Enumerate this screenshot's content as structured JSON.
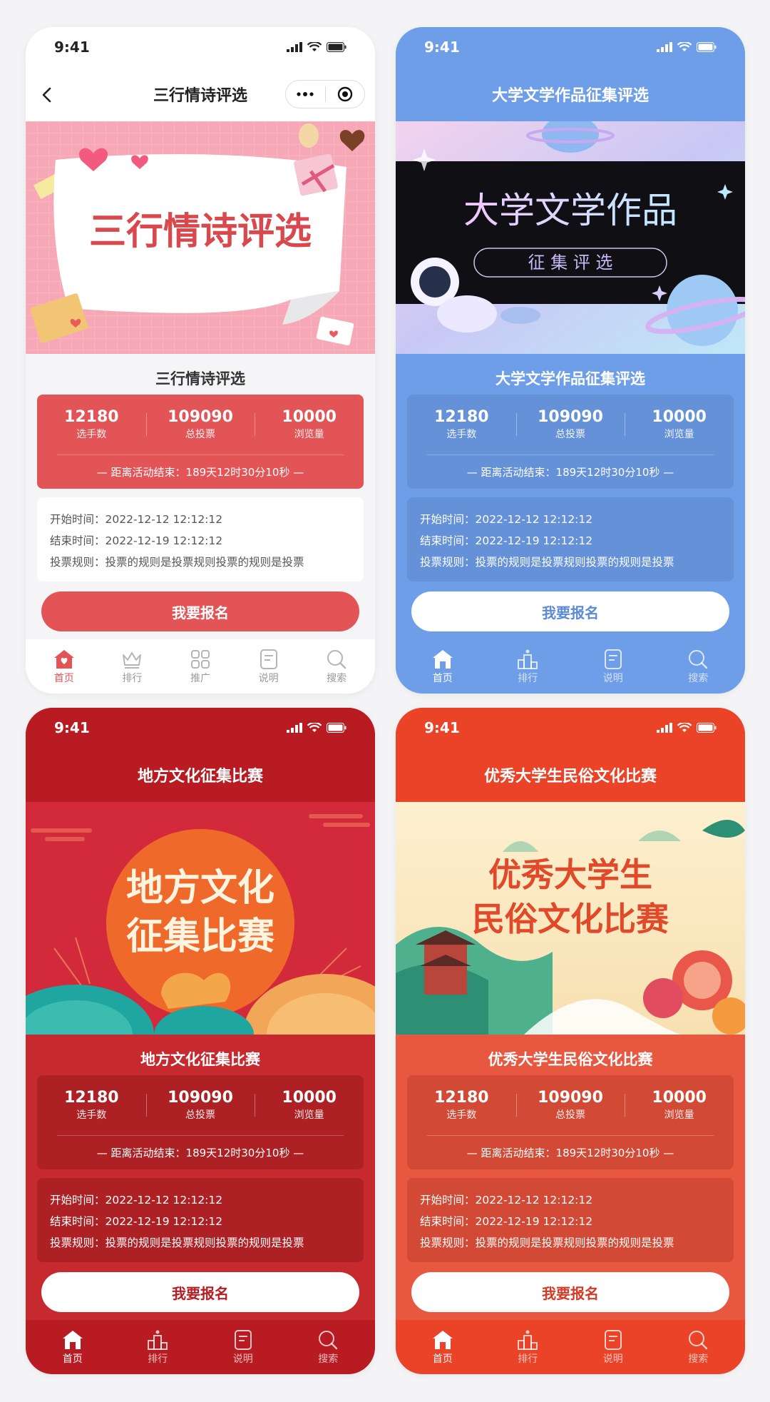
{
  "status_time": "9:41",
  "colors": {
    "pink_theme": "#e35457",
    "blue_theme": "#6f9ee8",
    "red_theme": "#b81c22",
    "orange_theme": "#ea4328"
  },
  "screens": [
    {
      "nav_title": "三行情诗评选",
      "banner_text": "三行情诗评选",
      "activity_title": "三行情诗评选",
      "stats": [
        {
          "value": "12180",
          "label": "选手数"
        },
        {
          "value": "109090",
          "label": "总投票"
        },
        {
          "value": "10000",
          "label": "浏览量"
        }
      ],
      "countdown": "— 距离活动结束：189天12时30分10秒 —",
      "info": [
        "开始时间：2022-12-12 12:12:12",
        "结束时间：2022-12-19 12:12:12",
        "投票规则：投票的规则是投票规则投票的规则是投票"
      ],
      "signup_label": "我要报名",
      "tabs": [
        {
          "label": "首页",
          "icon": "home-icon"
        },
        {
          "label": "排行",
          "icon": "crown-icon"
        },
        {
          "label": "推广",
          "icon": "grid-icon"
        },
        {
          "label": "说明",
          "icon": "document-icon"
        },
        {
          "label": "搜索",
          "icon": "search-icon"
        }
      ]
    },
    {
      "nav_title": "大学文学作品征集评选",
      "banner_text": "大学文学作品",
      "banner_subtext": "征 集 评 选",
      "activity_title": "大学文学作品征集评选",
      "stats": [
        {
          "value": "12180",
          "label": "选手数"
        },
        {
          "value": "109090",
          "label": "总投票"
        },
        {
          "value": "10000",
          "label": "浏览量"
        }
      ],
      "countdown": "— 距离活动结束：189天12时30分10秒 —",
      "info": [
        "开始时间：2022-12-12 12:12:12",
        "结束时间：2022-12-19 12:12:12",
        "投票规则：投票的规则是投票规则投票的规则是投票"
      ],
      "signup_label": "我要报名",
      "tabs": [
        {
          "label": "首页",
          "icon": "home-icon"
        },
        {
          "label": "排行",
          "icon": "ranking-icon"
        },
        {
          "label": "说明",
          "icon": "document-icon"
        },
        {
          "label": "搜索",
          "icon": "search-icon"
        }
      ]
    },
    {
      "nav_title": "地方文化征集比赛",
      "banner_line1": "地方文化",
      "banner_line2": "征集比赛",
      "activity_title": "地方文化征集比赛",
      "stats": [
        {
          "value": "12180",
          "label": "选手数"
        },
        {
          "value": "109090",
          "label": "总投票"
        },
        {
          "value": "10000",
          "label": "浏览量"
        }
      ],
      "countdown": "— 距离活动结束：189天12时30分10秒 —",
      "info": [
        "开始时间：2022-12-12 12:12:12",
        "结束时间：2022-12-19 12:12:12",
        "投票规则：投票的规则是投票规则投票的规则是投票"
      ],
      "signup_label": "我要报名",
      "tabs": [
        {
          "label": "首页",
          "icon": "home-icon"
        },
        {
          "label": "排行",
          "icon": "ranking-icon"
        },
        {
          "label": "说明",
          "icon": "document-icon"
        },
        {
          "label": "搜索",
          "icon": "search-icon"
        }
      ]
    },
    {
      "nav_title": "优秀大学生民俗文化比赛",
      "banner_line1": "优秀大学生",
      "banner_line2": "民俗文化比赛",
      "activity_title": "优秀大学生民俗文化比赛",
      "stats": [
        {
          "value": "12180",
          "label": "选手数"
        },
        {
          "value": "109090",
          "label": "总投票"
        },
        {
          "value": "10000",
          "label": "浏览量"
        }
      ],
      "countdown": "— 距离活动结束：189天12时30分10秒 —",
      "info": [
        "开始时间：2022-12-12 12:12:12",
        "结束时间：2022-12-19 12:12:12",
        "投票规则：投票的规则是投票规则投票的规则是投票"
      ],
      "signup_label": "我要报名",
      "tabs": [
        {
          "label": "首页",
          "icon": "home-icon"
        },
        {
          "label": "排行",
          "icon": "ranking-icon"
        },
        {
          "label": "说明",
          "icon": "document-icon"
        },
        {
          "label": "搜索",
          "icon": "search-icon"
        }
      ]
    }
  ]
}
